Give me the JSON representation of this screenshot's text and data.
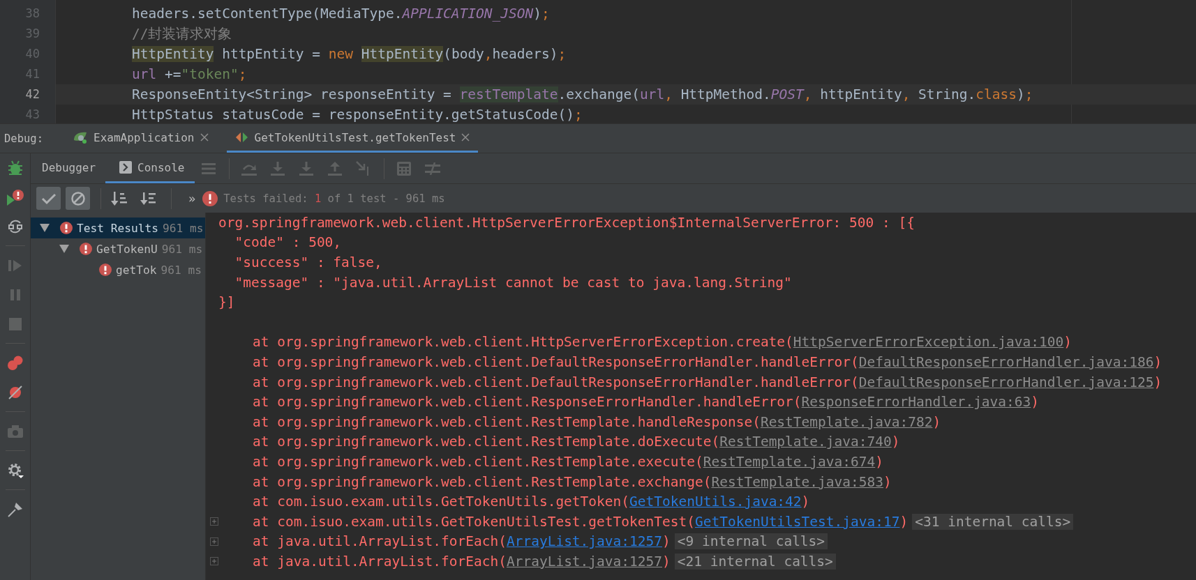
{
  "editor": {
    "lines": [
      {
        "number": "38",
        "current": false,
        "segments": [
          {
            "kind": "plain",
            "text": "headers.setContentType(MediaType."
          },
          {
            "kind": "static",
            "text": "APPLICATION_JSON"
          },
          {
            "kind": "plain",
            "text": ")"
          },
          {
            "kind": "keyword",
            "text": ";"
          }
        ]
      },
      {
        "number": "39",
        "current": false,
        "segments": [
          {
            "kind": "comment",
            "text": "//封装请求对象"
          }
        ]
      },
      {
        "number": "40",
        "current": false,
        "segments": [
          {
            "kind": "usage",
            "text": "HttpEntity"
          },
          {
            "kind": "plain",
            "text": " httpEntity = "
          },
          {
            "kind": "keyword",
            "text": "new "
          },
          {
            "kind": "usage",
            "text": "HttpEntity"
          },
          {
            "kind": "plain",
            "text": "(body"
          },
          {
            "kind": "keyword",
            "text": ","
          },
          {
            "kind": "plain",
            "text": "headers)"
          },
          {
            "kind": "keyword",
            "text": ";"
          }
        ]
      },
      {
        "number": "41",
        "current": false,
        "segments": [
          {
            "kind": "field",
            "text": "url "
          },
          {
            "kind": "plain",
            "text": "+="
          },
          {
            "kind": "string",
            "text": "\"token\""
          },
          {
            "kind": "keyword",
            "text": ";"
          }
        ]
      },
      {
        "number": "42",
        "current": true,
        "segments": [
          {
            "kind": "plain",
            "text": "ResponseEntity<String> responseEntity = "
          },
          {
            "kind": "field_usage",
            "text": "restTemplate"
          },
          {
            "kind": "plain",
            "text": ".exchange("
          },
          {
            "kind": "field",
            "text": "url"
          },
          {
            "kind": "keyword",
            "text": ", "
          },
          {
            "kind": "plain",
            "text": "HttpMethod."
          },
          {
            "kind": "static",
            "text": "POST"
          },
          {
            "kind": "keyword",
            "text": ", "
          },
          {
            "kind": "plain",
            "text": "httpEntity"
          },
          {
            "kind": "keyword",
            "text": ", "
          },
          {
            "kind": "plain",
            "text": "String."
          },
          {
            "kind": "keyword",
            "text": "class"
          },
          {
            "kind": "plain",
            "text": ")"
          },
          {
            "kind": "keyword",
            "text": ";"
          }
        ]
      },
      {
        "number": "43",
        "current": false,
        "segments": [
          {
            "kind": "plain",
            "text": "HttpStatus statusCode = responseEntity.getStatusCode()"
          },
          {
            "kind": "keyword",
            "text": ";"
          }
        ]
      }
    ]
  },
  "debug_bar": {
    "label": "Debug:",
    "tabs": [
      {
        "kind": "app",
        "label": "ExamApplication",
        "selected": false
      },
      {
        "kind": "test",
        "label": "GetTokenUtilsTest.getTokenTest",
        "selected": true
      }
    ]
  },
  "sub_tabs": [
    {
      "kind": "debugger",
      "label": "Debugger",
      "selected": false
    },
    {
      "kind": "console",
      "label": "Console",
      "selected": true
    }
  ],
  "test_toolbar": {
    "buttons": [
      {
        "kind": "passed",
        "pressed": true
      },
      {
        "kind": "ignored",
        "pressed": true
      },
      {
        "kind": "sort_alpha",
        "pressed": false
      },
      {
        "kind": "sort_duration",
        "pressed": false
      }
    ],
    "more": "»",
    "status": {
      "label": "Tests failed:",
      "failed": "1",
      "summary": "of 1 test - 961 ms"
    }
  },
  "tree": [
    {
      "label": "Test Results",
      "time": "961 ms",
      "selected": true,
      "expanded": true,
      "children": [
        {
          "label": "GetTokenU",
          "time": "961 ms",
          "selected": false,
          "expanded": true,
          "children": [
            {
              "label": "getTok",
              "time": "961 ms",
              "selected": false
            }
          ]
        }
      ]
    }
  ],
  "console": {
    "lines": [
      "org.springframework.web.client.HttpServerErrorException$InternalServerError: 500 : [{",
      "  \"code\" : 500,",
      "  \"success\" : false,",
      "  \"message\" : \"java.util.ArrayList cannot be cast to java.lang.String\"",
      "}]"
    ],
    "frames": [
      {
        "call": "at org.springframework.web.client.HttpServerErrorException.create(",
        "source": "HttpServerErrorException.java:100",
        "kind": "library",
        "close": ")"
      },
      {
        "call": "at org.springframework.web.client.DefaultResponseErrorHandler.handleError(",
        "source": "DefaultResponseErrorHandler.java:186",
        "kind": "library",
        "close": ")"
      },
      {
        "call": "at org.springframework.web.client.DefaultResponseErrorHandler.handleError(",
        "source": "DefaultResponseErrorHandler.java:125",
        "kind": "library",
        "close": ")"
      },
      {
        "call": "at org.springframework.web.client.ResponseErrorHandler.handleError(",
        "source": "ResponseErrorHandler.java:63",
        "kind": "library",
        "close": ")"
      },
      {
        "call": "at org.springframework.web.client.RestTemplate.handleResponse(",
        "source": "RestTemplate.java:782",
        "kind": "library",
        "close": ")"
      },
      {
        "call": "at org.springframework.web.client.RestTemplate.doExecute(",
        "source": "RestTemplate.java:740",
        "kind": "library",
        "close": ")"
      },
      {
        "call": "at org.springframework.web.client.RestTemplate.execute(",
        "source": "RestTemplate.java:674",
        "kind": "library",
        "close": ")"
      },
      {
        "call": "at org.springframework.web.client.RestTemplate.exchange(",
        "source": "RestTemplate.java:583",
        "kind": "library",
        "close": ")"
      },
      {
        "call": "at com.isuo.exam.utils.GetTokenUtils.getToken(",
        "source": "GetTokenUtils.java:42",
        "kind": "project",
        "close": ")"
      },
      {
        "call": "at com.isuo.exam.utils.GetTokenUtilsTest.getTokenTest(",
        "source": "GetTokenUtilsTest.java:17",
        "kind": "project",
        "close": ")",
        "internal_calls": "<31 internal calls>"
      },
      {
        "call": "at java.util.ArrayList.forEach(",
        "source": "ArrayList.java:1257",
        "kind": "project",
        "close": ")",
        "internal_calls": "<9 internal calls>"
      },
      {
        "call": "at java.util.ArrayList.forEach(",
        "source": "ArrayList.java:1257",
        "kind": "library",
        "close": ")",
        "internal_calls": "<21 internal calls>"
      }
    ]
  }
}
